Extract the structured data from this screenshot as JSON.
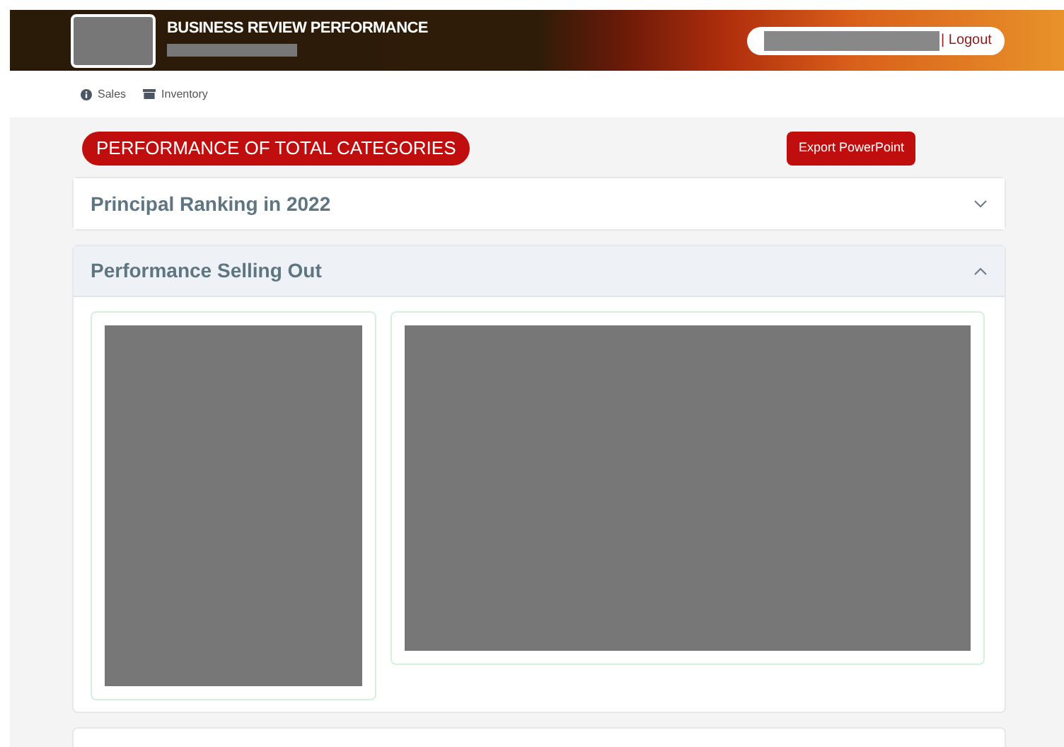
{
  "header": {
    "title": "BUSINESS REVIEW PERFORMANCE",
    "logout": "| Logout"
  },
  "nav": [
    {
      "label": "Sales",
      "kind": "info"
    },
    {
      "label": "Inventory",
      "kind": "box"
    }
  ],
  "page_title": "PERFORMANCE OF TOTAL CATEGORIES",
  "export_button": "Export PowerPoint",
  "sections": [
    {
      "title": "Principal Ranking in 2022",
      "expanded": false
    },
    {
      "title": "Performance Selling Out",
      "expanded": true
    }
  ]
}
